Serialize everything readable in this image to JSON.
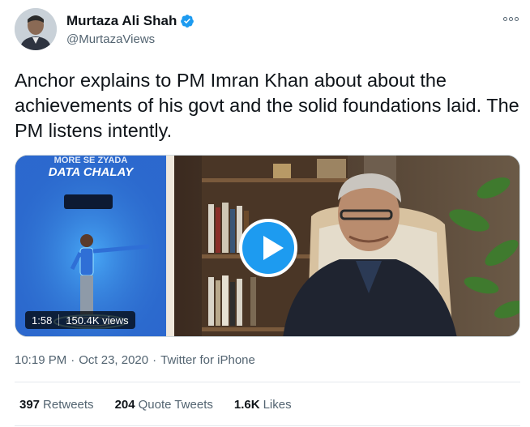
{
  "author": {
    "display_name": "Murtaza Ali Shah",
    "handle": "@MurtazaViews",
    "verified": true,
    "verified_color": "#1d9bf0"
  },
  "tweet": {
    "text": "Anchor explains to PM Imran Khan about about the achievements of his govt and the solid foundations laid. The PM listens intently."
  },
  "video": {
    "duration": "1:58",
    "views": "150.4K views",
    "overlay_heading": "DATA CHALAY",
    "overlay_top_text": "MORE SE ZYADA",
    "play_color": "#1d9bf0"
  },
  "meta": {
    "time": "10:19 PM",
    "separator": "·",
    "date": "Oct 23, 2020",
    "source": "Twitter for iPhone"
  },
  "stats": {
    "retweets_count": "397",
    "retweets_label": "Retweets",
    "quotes_count": "204",
    "quotes_label": "Quote Tweets",
    "likes_count": "1.6K",
    "likes_label": "Likes"
  }
}
